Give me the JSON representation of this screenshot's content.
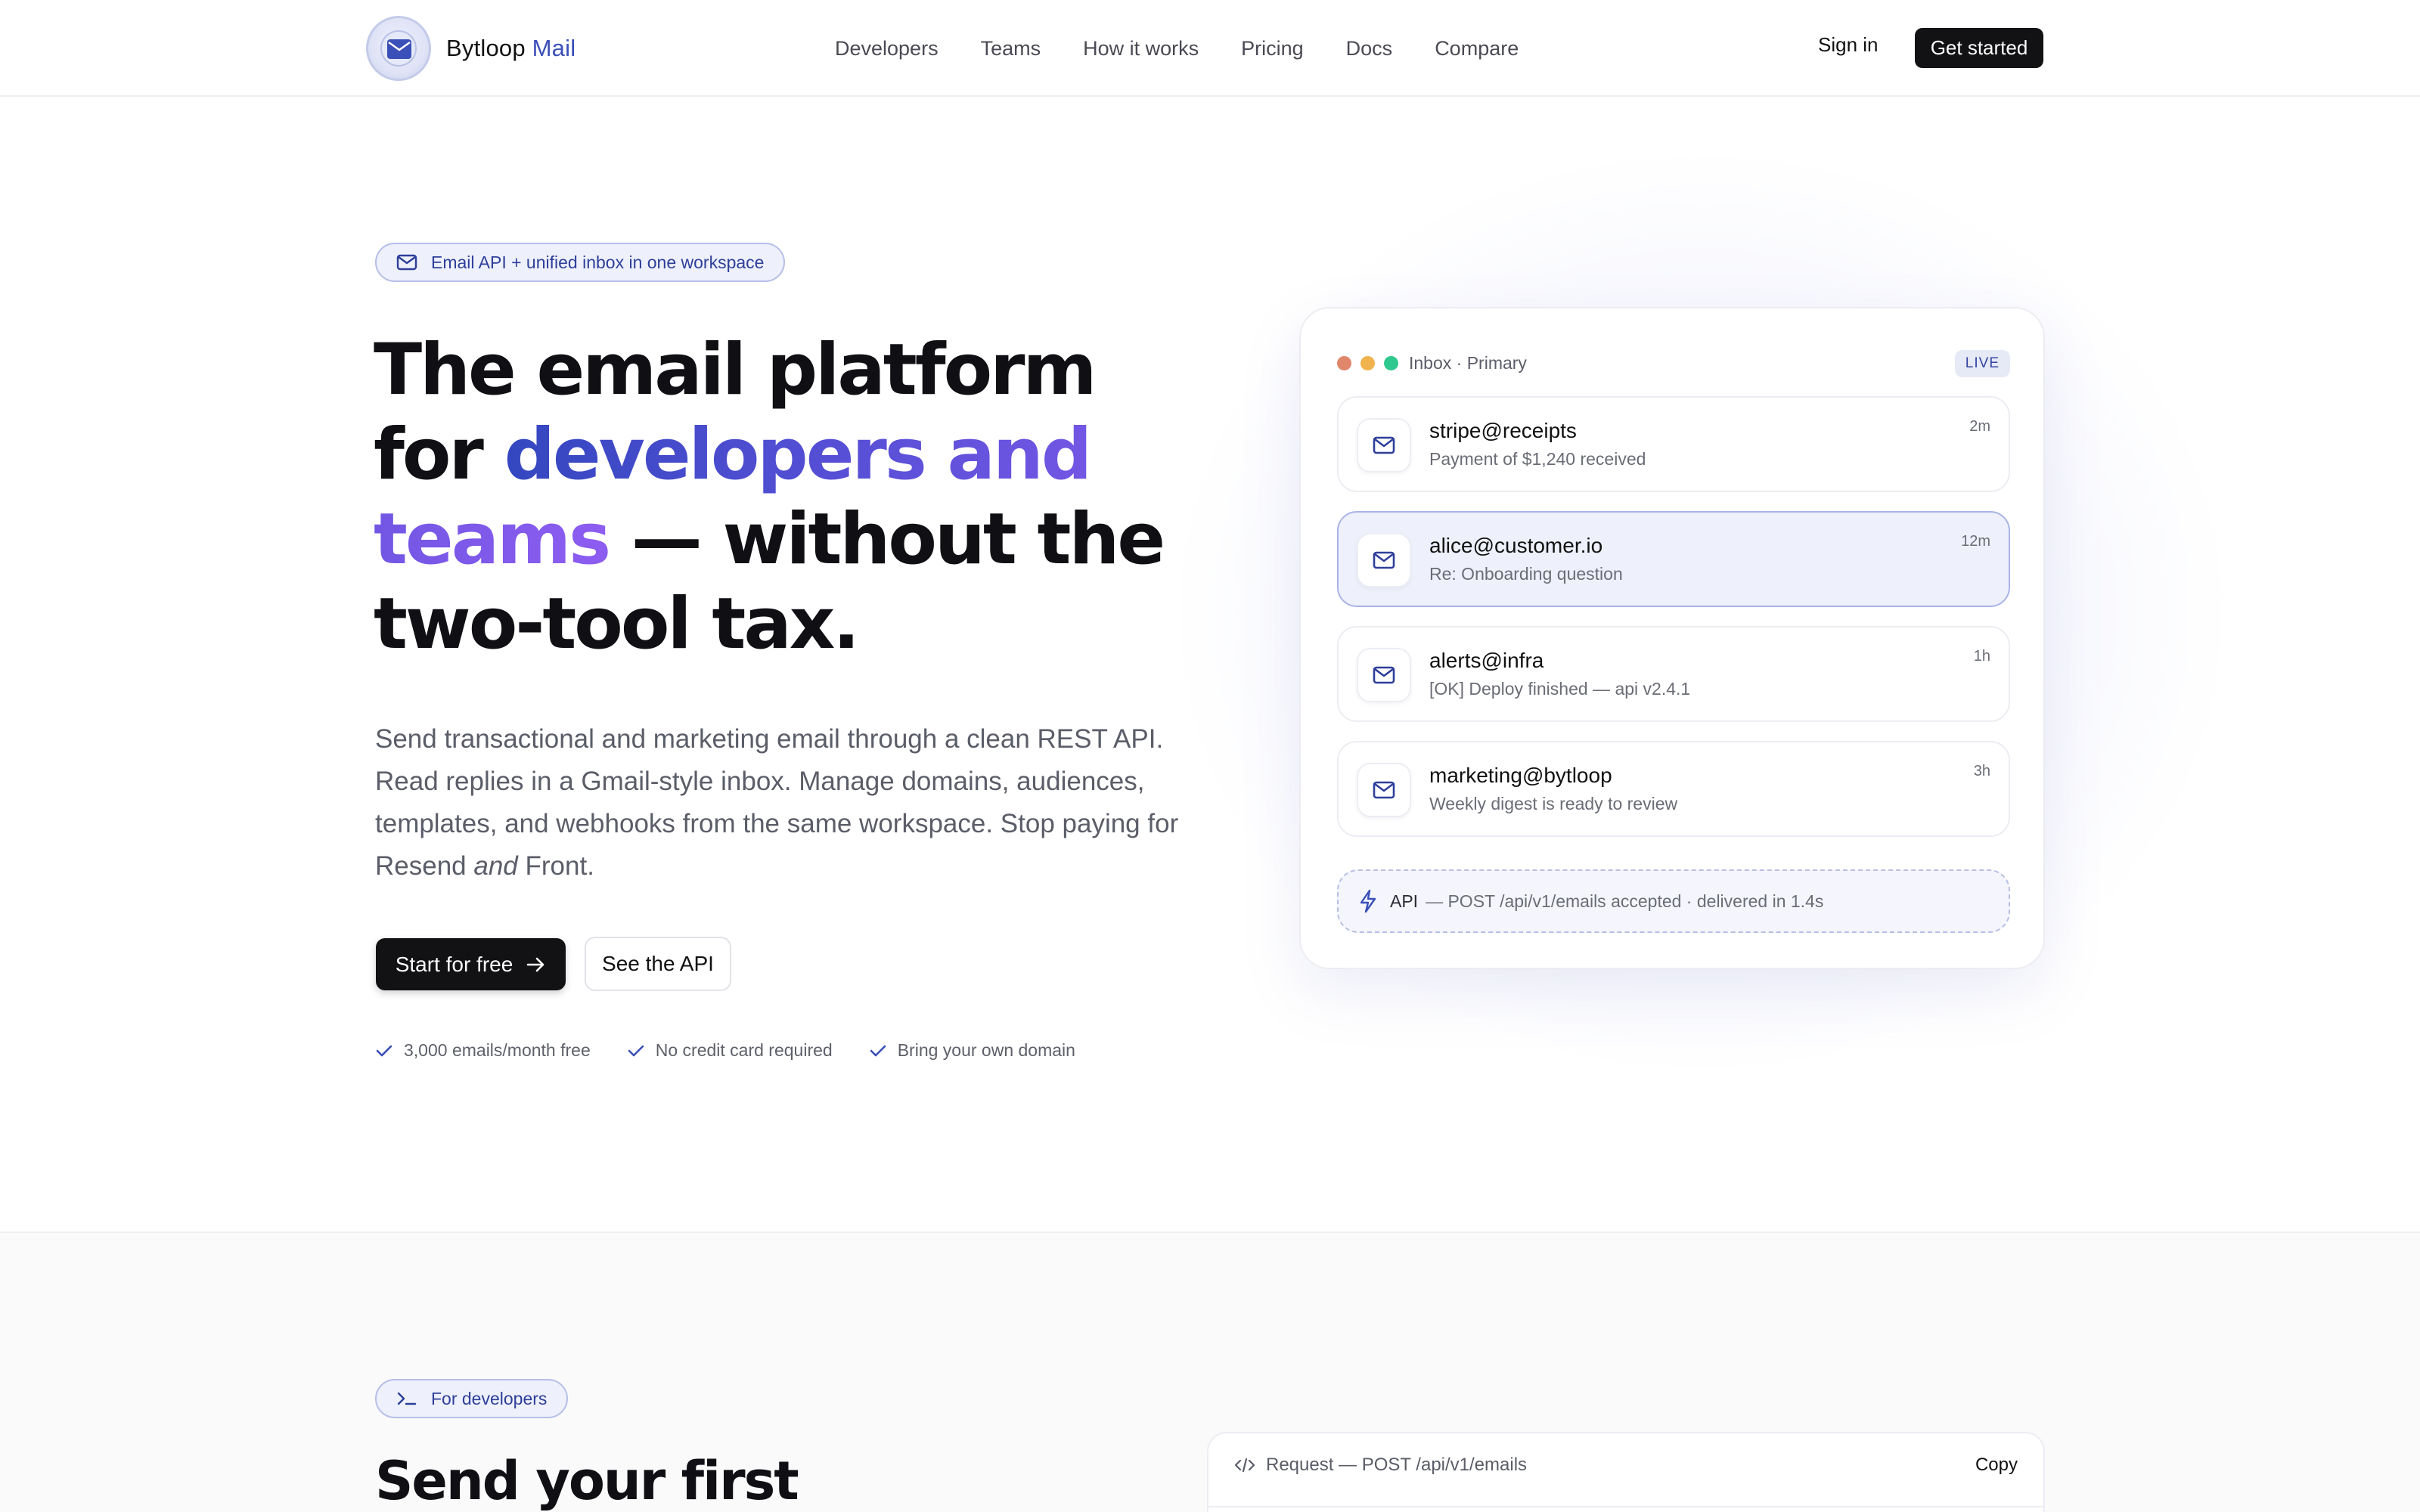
{
  "nav": {
    "brand_name": "Bytloop",
    "brand_accent": "Mail",
    "links": [
      "Developers",
      "Teams",
      "How it works",
      "Pricing",
      "Docs",
      "Compare"
    ],
    "sign_in": "Sign in",
    "get_started": "Get started"
  },
  "hero": {
    "pill": "Email API + unified inbox in one workspace",
    "title_part1": "The email platform for ",
    "title_gradient": "developers and teams",
    "title_part2": " — without the two-tool tax.",
    "sub_part1": "Send transactional and marketing email through a clean REST API. Read replies in a Gmail-style inbox. Manage domains, audiences, templates, and webhooks from the same workspace. Stop paying for Resend ",
    "sub_em": "and",
    "sub_part2": " Front.",
    "cta_primary": "Start for free",
    "cta_secondary": "See the API",
    "checks": [
      "3,000 emails/month free",
      "No credit card required",
      "Bring your own domain"
    ]
  },
  "inbox": {
    "title": "Inbox · Primary",
    "badge": "LIVE",
    "dots": [
      "#e0866a",
      "#f0b34d",
      "#2fc98f"
    ],
    "items": [
      {
        "from": "stripe@receipts",
        "subject": "Payment of $1,240 received",
        "time": "2m"
      },
      {
        "from": "alice@customer.io",
        "subject": "Re: Onboarding question",
        "time": "12m"
      },
      {
        "from": "alerts@infra",
        "subject": "[OK] Deploy finished — api v2.4.1",
        "time": "1h"
      },
      {
        "from": "marketing@bytloop",
        "subject": "Weekly digest is ready to review",
        "time": "3h"
      }
    ],
    "api_label": "API",
    "api_text": "— POST /api/v1/emails accepted · delivered in 1.4s"
  },
  "developers": {
    "pill": "For developers",
    "title": "Send your first",
    "request_label": "Request — POST /api/v1/emails",
    "copy": "Copy"
  },
  "colors": {
    "accent": "#3a4fb8",
    "gradient_start": "#3447c0",
    "gradient_end": "#8d5df1",
    "dark_button": "#121214"
  }
}
